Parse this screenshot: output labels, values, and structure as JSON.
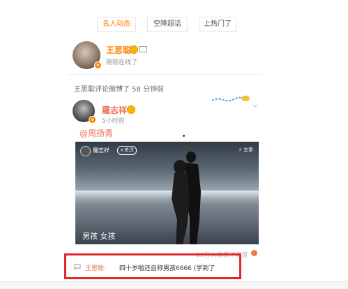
{
  "tabs": [
    {
      "label": "名人动态",
      "active": true
    },
    {
      "label": "空降超话",
      "active": false
    },
    {
      "label": "上热门了",
      "active": false
    }
  ],
  "profile": {
    "name": "王思聪",
    "status": "刚刚在线了"
  },
  "comment_notice": "王思聪评论微博了 58 分钟前",
  "post": {
    "author": "羅志祥",
    "time": "5小时前",
    "mention": "@周扬青",
    "photo": {
      "author": "羅志祥",
      "follow_label": "+关注",
      "tag": "文章",
      "caption": "男孩 女孩"
    },
    "views": "19万人发表了态度"
  },
  "reply": {
    "name": "王思聪:",
    "text": "四十岁啦还自称男孩6666 (学到了"
  },
  "colors": {
    "accent": "#ff8200",
    "name_link": "#eb7350",
    "highlight_box": "#e0282a"
  },
  "icons": [
    "vip-badge-icon",
    "emoji-icon",
    "card-icon",
    "chevron-down-icon",
    "comment-icon"
  ]
}
